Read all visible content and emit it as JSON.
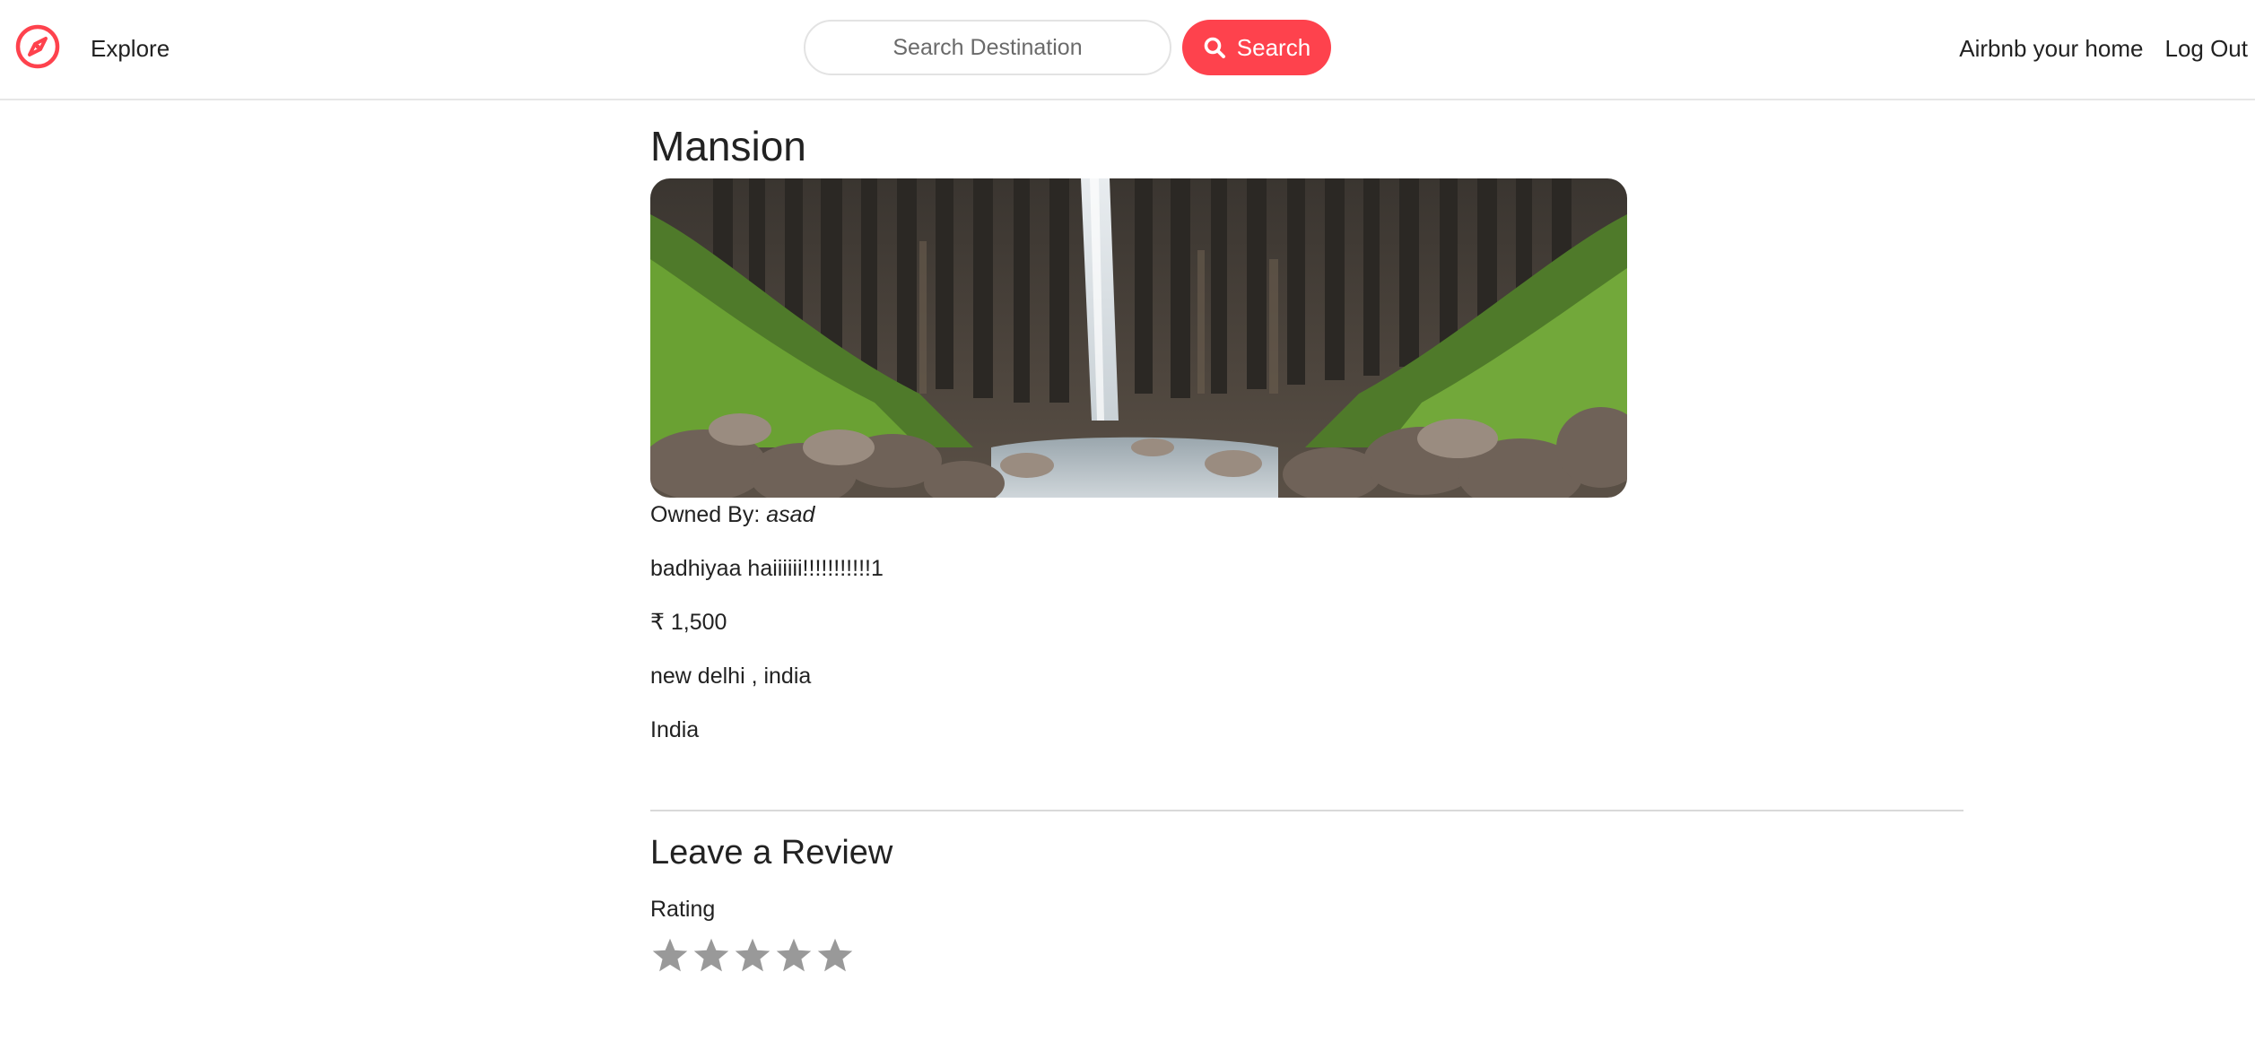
{
  "nav": {
    "brand_icon": "compass-icon",
    "explore_label": "Explore",
    "search_placeholder": "Search Destination",
    "search_button_label": "Search",
    "host_label": "Airbnb your home",
    "logout_label": "Log Out"
  },
  "listing": {
    "title": "Mansion",
    "owner_prefix": "Owned By:",
    "owner_name": "asad",
    "description": "badhiyaa haiiiiii!!!!!!!!!!!1",
    "price": "₹ 1,500",
    "location": "new delhi , india",
    "country": "India"
  },
  "review": {
    "title": "Leave a Review",
    "rating_label": "Rating",
    "stars_total": 5,
    "stars_selected": 0
  },
  "colors": {
    "brand": "#fe424d",
    "star_empty": "#999999"
  }
}
